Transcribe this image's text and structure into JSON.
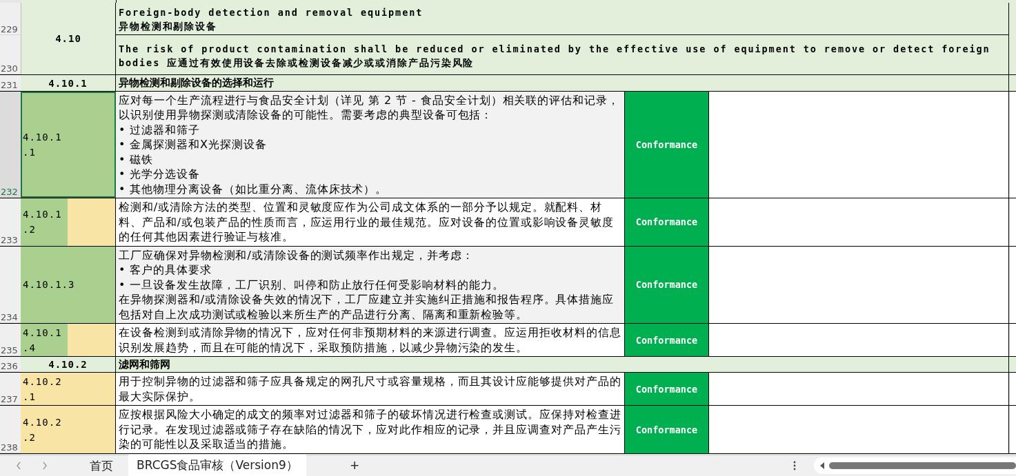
{
  "section": {
    "code": "4.10",
    "rows": [
      {
        "row_number": "229",
        "lines": [
          "Foreign-body detection and removal equipment",
          "异物检测和剔除设备"
        ]
      },
      {
        "row_number": "230",
        "lines": [
          "The risk of product contamination shall be reduced or eliminated by the effective use of equipment to remove or detect foreign bodies 应通过有效使用设备去除或检测设备减少或或消除产品污染风险"
        ]
      }
    ]
  },
  "rows": [
    {
      "kind": "subheading",
      "row_number": "231",
      "code": "4.10.1",
      "title": "异物检测和剔除设备的选择和运行"
    },
    {
      "kind": "clause",
      "row_number": "232",
      "selected": true,
      "code": {
        "lines": [
          "4.10.1",
          ".1"
        ],
        "kind": "green"
      },
      "shaded": true,
      "lines": [
        "应对每一个生产流程进行与食品安全计划（详见 第 2 节 - 食品安全计划）相关联的评估和记录，以识别使用异物探测或清除设备的可能性。需要考虑的典型设备可包括：",
        "• 过滤器和筛子",
        "• 金属探测器和X光探测设备",
        "• 磁铁",
        "• 光学分选设备",
        "• 其他物理分离设备（如比重分离、流体床技术）。"
      ],
      "status": "Conformance"
    },
    {
      "kind": "clause",
      "row_number": "233",
      "selected": false,
      "code": {
        "lines": [
          "4.10.1",
          ".2"
        ],
        "kind": "split"
      },
      "shaded": false,
      "lines": [
        "检测和/或清除方法的类型、位置和灵敏度应作为公司成文体系的一部分予以规定。就配料、材料、产品和/或包装产品的性质而言，应运用行业的最佳规范。应对设备的位置或影响设备灵敏度的任何其他因素进行验证与核准。"
      ],
      "status": "Conformance"
    },
    {
      "kind": "clause",
      "row_number": "234",
      "selected": false,
      "code": {
        "lines": [
          "4.10.1.3"
        ],
        "kind": "green"
      },
      "shaded": true,
      "lines": [
        "工厂应确保对异物检测和/或清除设备的测试频率作出规定，并考虑：",
        "• 客户的具体要求",
        "• 一旦设备发生故障，工厂识别、叫停和防止放行任何受影响材料的能力。",
        "在异物探测器和/或清除设备失效的情况下，工厂应建立并实施纠正措施和报告程序。具体措施应包括对自上次成功测试或检验以来所生产的产品进行分离、隔离和重新检验等。"
      ],
      "status": "Conformance"
    },
    {
      "kind": "clause",
      "row_number": "235",
      "selected": false,
      "code": {
        "lines": [
          "4.10.1",
          ".4"
        ],
        "kind": "split"
      },
      "shaded": false,
      "lines": [
        "在设备检测到或清除异物的情况下，应对任何非预期材料的来源进行调查。应运用拒收材料的信息识别发展趋势，而且在可能的情况下，采取预防措施，以减少异物污染的发生。"
      ],
      "status": "Conformance"
    },
    {
      "kind": "subheading",
      "row_number": "236",
      "code": "4.10.2",
      "title": "滤网和筛网"
    },
    {
      "kind": "clause",
      "row_number": "237",
      "selected": false,
      "code": {
        "lines": [
          "4.10.2",
          ".1"
        ],
        "kind": "yellow"
      },
      "shaded": false,
      "lines": [
        "用于控制异物的过滤器和筛子应具备规定的网孔尺寸或容量规格，而且其设计应能够提供对产品的最大实际保护。"
      ],
      "status": "Conformance"
    },
    {
      "kind": "clause",
      "row_number": "238",
      "selected": false,
      "code": {
        "lines": [
          "4.10.2",
          ".2"
        ],
        "kind": "yellow"
      },
      "shaded": false,
      "lines": [
        "应按根据风险大小确定的成文的频率对过滤器和筛子的破坏情况进行检查或测试。应保持对检查进行记录。在发现过滤器或筛子存在缺陷的情况下，应对此作相应的记录，并且应调查对产品产生污染的可能性以及采取适当的措施。"
      ],
      "status": "Conformance"
    }
  ],
  "sheet_tabs": [
    {
      "label": "首页",
      "selected": false
    },
    {
      "label": "BRCGS食品审核（Version9）",
      "selected": true
    }
  ],
  "add_tab": "+"
}
